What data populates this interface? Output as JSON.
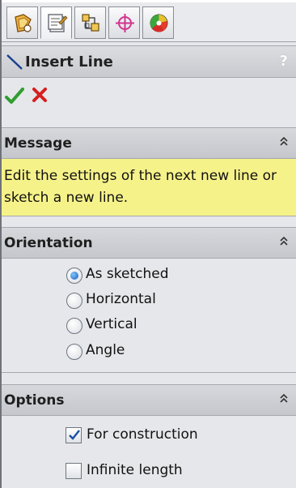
{
  "tabs": [
    {
      "icon": "feature-manager-icon",
      "active": false
    },
    {
      "icon": "property-manager-icon",
      "active": true
    },
    {
      "icon": "configuration-manager-icon",
      "active": false
    },
    {
      "icon": "dimxpert-manager-icon",
      "active": false
    },
    {
      "icon": "display-manager-icon",
      "active": false
    }
  ],
  "panel": {
    "title": "Insert Line",
    "help": "?"
  },
  "message": {
    "header": "Message",
    "text": "Edit the settings of the next new line or sketch a new line."
  },
  "orientation": {
    "header": "Orientation",
    "selected": "As sketched",
    "options": [
      "As sketched",
      "Horizontal",
      "Vertical",
      "Angle"
    ]
  },
  "options": {
    "header": "Options",
    "items": [
      {
        "label": "For construction",
        "checked": true
      },
      {
        "label": "Infinite length",
        "checked": false
      }
    ]
  },
  "colors": {
    "message_bg": "#f6f28a",
    "ok_green": "#2f9e2f",
    "cancel_red": "#d42020",
    "radio_blue": "#1b5fb3"
  }
}
